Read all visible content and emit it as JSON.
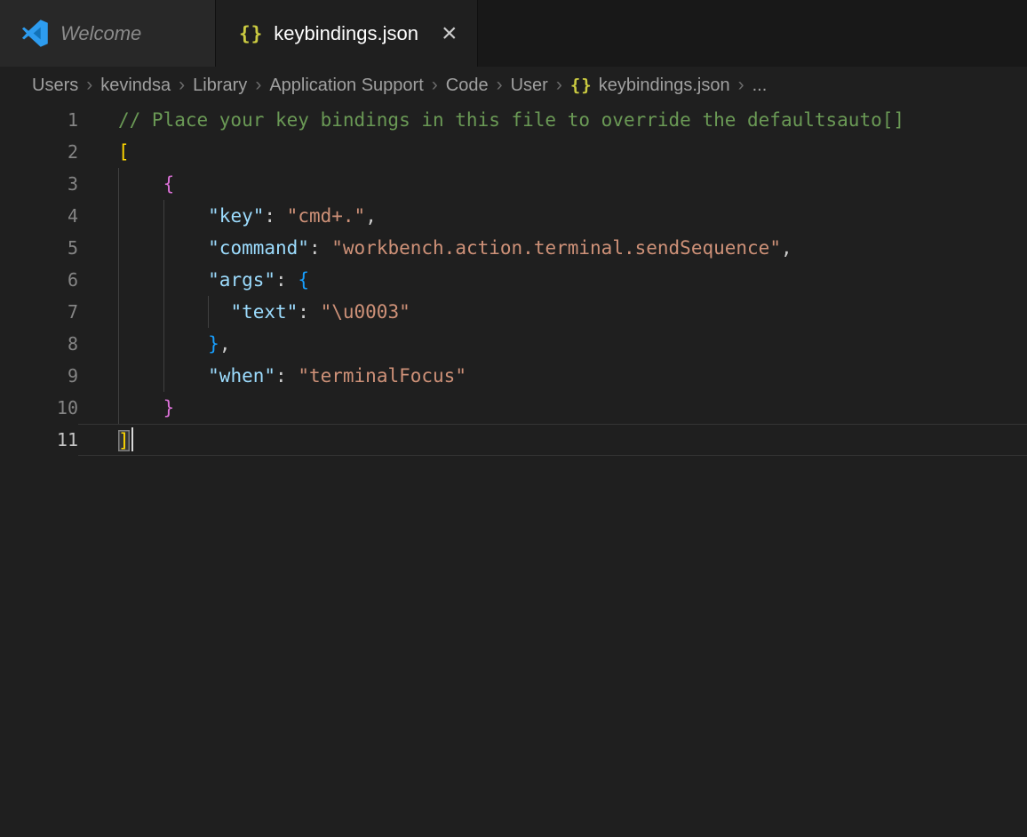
{
  "theme": {
    "editor_bg": "#1f1f1f",
    "tabbar_bg": "#181818",
    "inactive_tab_bg": "#282828",
    "active_tab_bg": "#1f1f1f",
    "json_icon_color": "#CBCB41",
    "logo_blue": "#2D9CEF",
    "token_colors": {
      "comment": "#6A9955",
      "key": "#9CDCFE",
      "string": "#CE9178",
      "punct": "#CCCCCC",
      "bracket1": "#FFD700",
      "bracket2": "#DA70D6",
      "bracket3": "#179FFF"
    }
  },
  "tabs": [
    {
      "label": "Welcome",
      "icon": "vscode-logo",
      "active": false,
      "preview": true
    },
    {
      "label": "keybindings.json",
      "icon": "{}",
      "active": true,
      "close_label": "×"
    }
  ],
  "breadcrumb": {
    "separator": "›",
    "items": [
      {
        "label": "Users"
      },
      {
        "label": "kevindsa"
      },
      {
        "label": "Library"
      },
      {
        "label": "Application Support"
      },
      {
        "label": "Code"
      },
      {
        "label": "User"
      },
      {
        "label": "keybindings.json",
        "icon": "{}"
      },
      {
        "label": "..."
      }
    ]
  },
  "editor": {
    "active_line": 11,
    "cursor_line": 11,
    "lines": [
      {
        "num": 1,
        "tokens": [
          {
            "text": "// Place your key bindings in this file to override the defaultsauto[]",
            "color": "comment"
          }
        ]
      },
      {
        "num": 2,
        "tokens": [
          {
            "text": "[",
            "color": "bracket1"
          }
        ]
      },
      {
        "num": 3,
        "tokens": [
          {
            "text": "    ",
            "color": "punct"
          },
          {
            "text": "{",
            "color": "bracket2"
          }
        ]
      },
      {
        "num": 4,
        "tokens": [
          {
            "text": "        ",
            "color": "punct"
          },
          {
            "text": "\"key\"",
            "color": "key"
          },
          {
            "text": ": ",
            "color": "punct"
          },
          {
            "text": "\"cmd+.\"",
            "color": "string"
          },
          {
            "text": ",",
            "color": "punct"
          }
        ]
      },
      {
        "num": 5,
        "tokens": [
          {
            "text": "        ",
            "color": "punct"
          },
          {
            "text": "\"command\"",
            "color": "key"
          },
          {
            "text": ": ",
            "color": "punct"
          },
          {
            "text": "\"workbench.action.terminal.sendSequence\"",
            "color": "string"
          },
          {
            "text": ",",
            "color": "punct"
          }
        ]
      },
      {
        "num": 6,
        "tokens": [
          {
            "text": "        ",
            "color": "punct"
          },
          {
            "text": "\"args\"",
            "color": "key"
          },
          {
            "text": ": ",
            "color": "punct"
          },
          {
            "text": "{",
            "color": "bracket3"
          }
        ]
      },
      {
        "num": 7,
        "tokens": [
          {
            "text": "          ",
            "color": "punct"
          },
          {
            "text": "\"text\"",
            "color": "key"
          },
          {
            "text": ": ",
            "color": "punct"
          },
          {
            "text": "\"\\u0003\"",
            "color": "string"
          }
        ]
      },
      {
        "num": 8,
        "tokens": [
          {
            "text": "        ",
            "color": "punct"
          },
          {
            "text": "}",
            "color": "bracket3"
          },
          {
            "text": ",",
            "color": "punct"
          }
        ]
      },
      {
        "num": 9,
        "tokens": [
          {
            "text": "        ",
            "color": "punct"
          },
          {
            "text": "\"when\"",
            "color": "key"
          },
          {
            "text": ": ",
            "color": "punct"
          },
          {
            "text": "\"terminalFocus\"",
            "color": "string"
          }
        ]
      },
      {
        "num": 10,
        "tokens": [
          {
            "text": "    ",
            "color": "punct"
          },
          {
            "text": "}",
            "color": "bracket2"
          }
        ]
      },
      {
        "num": 11,
        "tokens": [
          {
            "text": "]",
            "color": "bracket1",
            "bracket_match": true
          }
        ]
      }
    ],
    "indent_guides": [
      {
        "col": 0,
        "from_line": 3,
        "to_line": 10
      },
      {
        "col": 4,
        "from_line": 4,
        "to_line": 9
      },
      {
        "col": 8,
        "from_line": 7,
        "to_line": 7
      }
    ]
  }
}
